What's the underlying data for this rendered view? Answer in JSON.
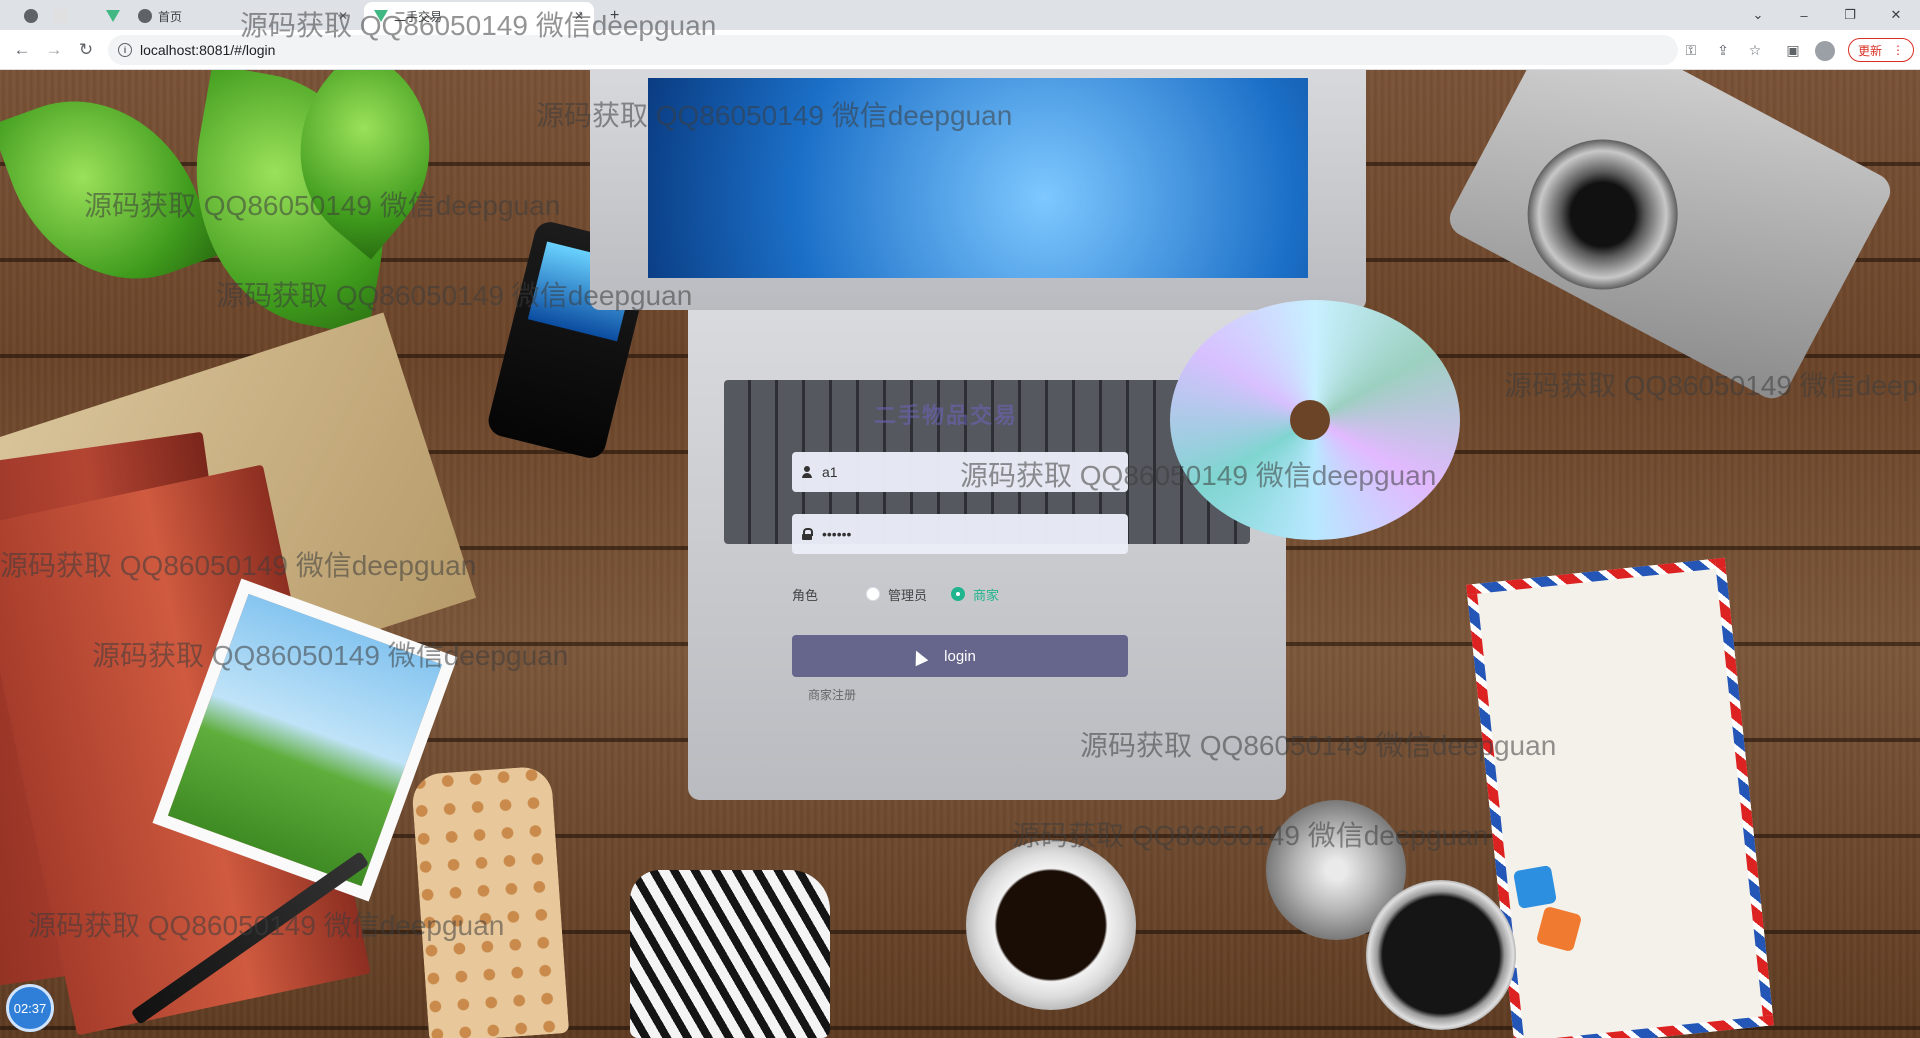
{
  "browser": {
    "tabs": [
      {
        "label": "首页"
      },
      {
        "label": "二手交易"
      }
    ],
    "window_controls": [
      "⌄",
      "–",
      "❐",
      "✕"
    ],
    "url": "localhost:8081/#/login",
    "update_label": "更新"
  },
  "login": {
    "title": "二手物品交易",
    "username_value": "a1",
    "password_value": "••••••",
    "role_label": "角色",
    "roles": [
      {
        "label": "管理员",
        "checked": false
      },
      {
        "label": "商家",
        "checked": true
      }
    ],
    "login_button": "login",
    "register_link": "商家注册"
  },
  "watermark_text": "源码获取 QQ86050149 微信deepguan",
  "clock": "02:37",
  "colors": {
    "login_button": "#66668c",
    "radio_checked": "#20b58e"
  }
}
